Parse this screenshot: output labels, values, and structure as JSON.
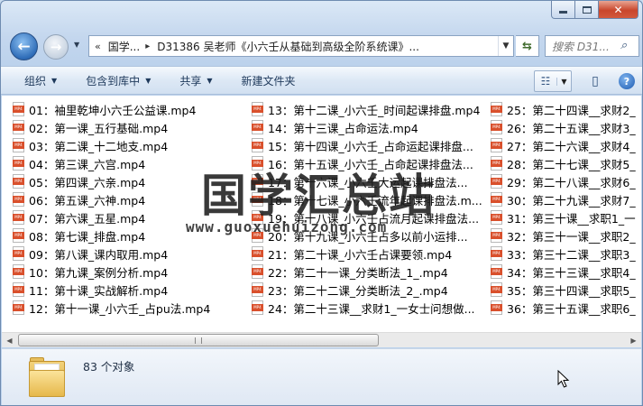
{
  "nav": {
    "address_segments": [
      "国学...",
      "D31386 吴老师《小六壬从基础到高级全阶系统课》..."
    ],
    "search_placeholder": "搜索 D31..."
  },
  "toolbar": {
    "organize": "组织",
    "include_library": "包含到库中",
    "share": "共享",
    "new_folder": "新建文件夹"
  },
  "files": {
    "col1": [
      "01：袖里乾坤小六壬公益课.mp4",
      "02：第一课_五行基础.mp4",
      "03：第二课_十二地支.mp4",
      "04：第三课_六宫.mp4",
      "05：第四课_六亲.mp4",
      "06：第五课_六神.mp4",
      "07：第六课_五星.mp4",
      "08：第七课_排盘.mp4",
      "09：第八课_课内取用.mp4",
      "10：第九课_案例分析.mp4",
      "11：第十课_实战解析.mp4",
      "12：第十一课_小六壬_占pu法.mp4"
    ],
    "col2": [
      "13：第十二课_小六壬_时间起课排盘.mp4",
      "14：第十三课_占命运法.mp4",
      "15：第十四课_小六壬_占命运起课排盘...",
      "16：第十五课_小六壬_占命起课排盘法...",
      "17：第十六课_小六壬大运起课排盘法...",
      "18：第十七课_小六壬流年起课排盘法.m...",
      "19：第十八课_小六壬占流月起课排盘法...",
      "20：第十九课_小六壬占多以前小运排...",
      "21：第二十课_小六壬占课要领.mp4",
      "22：第二十一课_分类断法_1_.mp4",
      "23：第二十二课_分类断法_2_.mp4",
      "24：第二十三课__求财1_一女士问想做..."
    ],
    "col3": [
      "25：第二十四课__求财2_",
      "26：第二十五课__求财3_",
      "27：第二十六课__求财4_",
      "28：第二十七课__求财5_",
      "29：第二十八课__求财6_",
      "30：第二十九课__求财7_",
      "31：第三十课__求职1_一",
      "32：第三十一课__求职2_",
      "33：第三十二课__求职3_",
      "34：第三十三课__求职4_",
      "35：第三十四课__求职5_",
      "36：第三十五课__求职6_"
    ]
  },
  "watermark": {
    "title": "国学汇总站",
    "url": "www.guoxuehuizong.com"
  },
  "status": {
    "item_count": "83 个对象"
  }
}
